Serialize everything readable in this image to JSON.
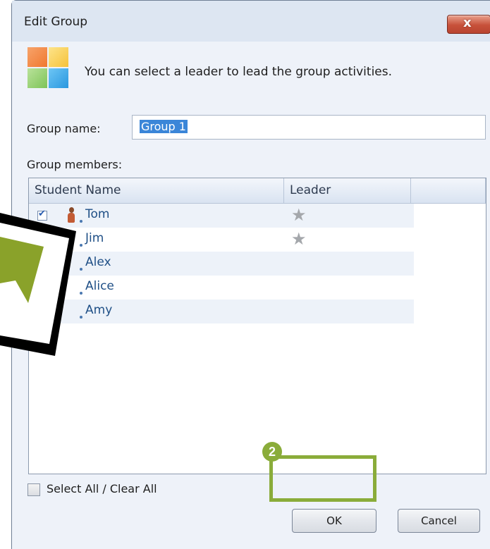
{
  "dialog": {
    "title": "Edit Group",
    "close_label": "x",
    "description": "You can select a leader to lead the group activities.",
    "group_name_label": "Group name:",
    "group_name_value": "Group 1",
    "group_members_label": "Group members:",
    "columns": [
      "Student Name",
      "Leader",
      ""
    ],
    "members": [
      {
        "name": "Tom",
        "checked": true,
        "leader_icon": "star-icon"
      },
      {
        "name": "Jim",
        "checked": false,
        "leader_icon": "star-icon"
      },
      {
        "name": "Alex",
        "checked": false,
        "leader_icon": null
      },
      {
        "name": "Alice",
        "checked": false,
        "leader_icon": null
      },
      {
        "name": "Amy",
        "checked": false,
        "leader_icon": null
      }
    ],
    "select_all_label": "Select All / Clear All",
    "ok_label": "OK",
    "cancel_label": "Cancel"
  },
  "annotation": {
    "step_number": "2",
    "highlight_color": "#8aac3a"
  },
  "colors": {
    "title_bar": "#dde6f2",
    "close_button": "#c7513a",
    "selection": "#3b86d8",
    "member_text": "#1f4f86",
    "pointer": "#8aa22a"
  }
}
